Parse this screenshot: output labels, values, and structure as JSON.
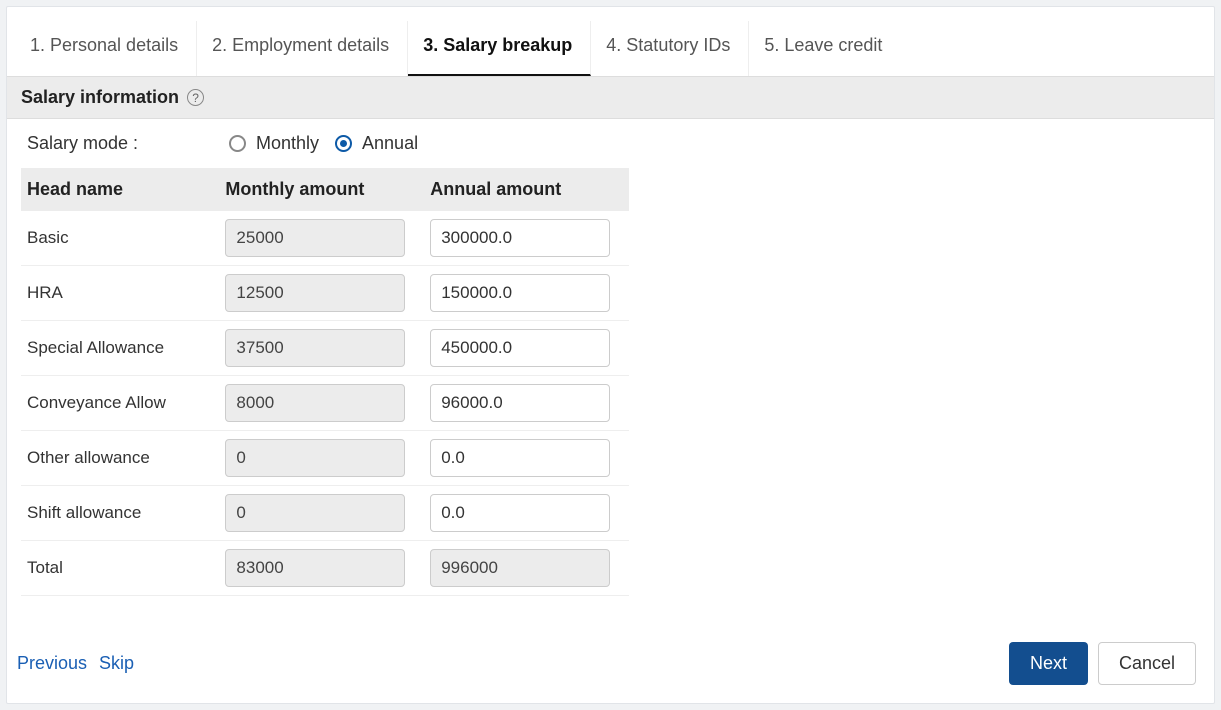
{
  "tabs": [
    {
      "label": "1. Personal details",
      "active": false
    },
    {
      "label": "2. Employment details",
      "active": false
    },
    {
      "label": "3. Salary breakup",
      "active": true
    },
    {
      "label": "4. Statutory IDs",
      "active": false
    },
    {
      "label": "5. Leave credit",
      "active": false
    }
  ],
  "section_title": "Salary information",
  "salary_mode": {
    "label": "Salary mode :",
    "options": [
      {
        "label": "Monthly",
        "selected": false
      },
      {
        "label": "Annual",
        "selected": true
      }
    ]
  },
  "table": {
    "headers": {
      "name": "Head name",
      "monthly": "Monthly amount",
      "annual": "Annual amount"
    },
    "rows": [
      {
        "name": "Basic",
        "monthly": "25000",
        "annual": "300000.0",
        "monthly_ro": true,
        "annual_ro": false
      },
      {
        "name": "HRA",
        "monthly": "12500",
        "annual": "150000.0",
        "monthly_ro": true,
        "annual_ro": false
      },
      {
        "name": "Special Allowance",
        "monthly": "37500",
        "annual": "450000.0",
        "monthly_ro": true,
        "annual_ro": false
      },
      {
        "name": "Conveyance Allow",
        "monthly": "8000",
        "annual": "96000.0",
        "monthly_ro": true,
        "annual_ro": false
      },
      {
        "name": "Other allowance",
        "monthly": "0",
        "annual": "0.0",
        "monthly_ro": true,
        "annual_ro": false
      },
      {
        "name": "Shift allowance",
        "monthly": "0",
        "annual": "0.0",
        "monthly_ro": true,
        "annual_ro": false
      },
      {
        "name": "Total",
        "monthly": "83000",
        "annual": "996000",
        "monthly_ro": true,
        "annual_ro": true
      }
    ]
  },
  "footer": {
    "previous": "Previous",
    "skip": "Skip",
    "next": "Next",
    "cancel": "Cancel"
  }
}
